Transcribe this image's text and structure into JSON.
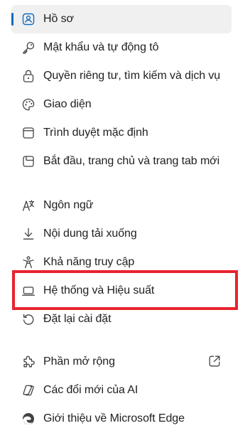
{
  "menu": {
    "items": [
      {
        "label": "Hồ sơ",
        "icon": "profile-icon",
        "selected": true
      },
      {
        "label": "Mật khẩu và tự động tô",
        "icon": "key-icon"
      },
      {
        "label": "Quyền riêng tư, tìm kiếm và dịch vụ",
        "icon": "lock-icon"
      },
      {
        "label": "Giao diện",
        "icon": "palette-icon"
      },
      {
        "label": "Trình duyệt mặc định",
        "icon": "browser-icon"
      },
      {
        "label": "Bắt đầu, trang chủ và trang tab mới",
        "icon": "new-tab-page-icon"
      },
      {
        "label": "Ngôn ngữ",
        "icon": "language-icon"
      },
      {
        "label": "Nội dung tải xuống",
        "icon": "download-icon"
      },
      {
        "label": "Khả năng truy cập",
        "icon": "accessibility-icon"
      },
      {
        "label": "Hệ thống và Hiệu suất",
        "icon": "laptop-icon",
        "highlighted": true
      },
      {
        "label": "Đặt lại cài đặt",
        "icon": "reset-icon"
      },
      {
        "label": "Phần mở rộng",
        "icon": "puzzle-icon",
        "external_link_icon": "external-link-icon"
      },
      {
        "label": "Các đổi mới của AI",
        "icon": "ai-innovations-icon"
      },
      {
        "label": "Giới thiệu về Microsoft Edge",
        "icon": "edge-logo-icon"
      }
    ]
  },
  "colors": {
    "accent": "#0f6cbd",
    "selected_background": "#f0f0f0",
    "highlight_border": "#e8242f",
    "text": "#1f1f1f",
    "icon": "#424242"
  }
}
